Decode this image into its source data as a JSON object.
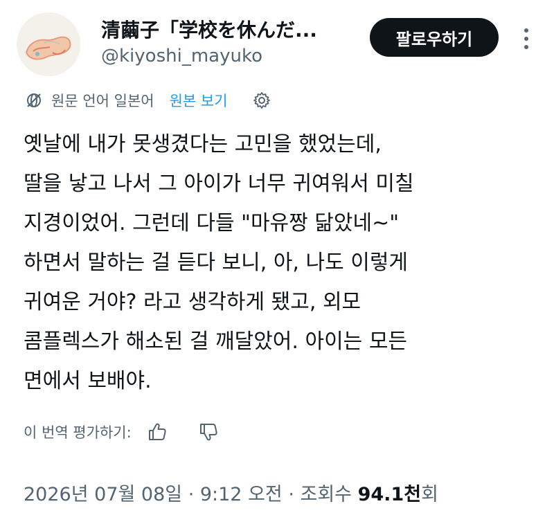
{
  "author": {
    "display_name": "清繭子「学校を休んだ...",
    "handle": "@kiyoshi_mayuko",
    "avatar_icon": "avatar-illustration"
  },
  "follow_label": "팔로우하기",
  "translation": {
    "source_language_label": "원문 언어 일본어",
    "view_original_label": "원본 보기",
    "globe_icon": "globe-slash-icon",
    "settings_icon": "gear-icon"
  },
  "tweet_lines": [
    "옛날에 내가 못생겼다는 고민을 했었는데,",
    "딸을 낳고 나서 그 아이가 너무 귀여워서 미칠",
    "지경이었어. 그런데 다들 \"마유짱 닮았네~\"",
    "하면서 말하는 걸 듣다 보니, 아, 나도 이렇게",
    "귀여운 거야? 라고 생각하게 됐고, 외모",
    "콤플렉스가 해소된 걸 깨달았어. 아이는 모든",
    "면에서 보배야."
  ],
  "rating": {
    "label": "이 번역 평가하기:",
    "thumbs_up_icon": "thumbs-up-icon",
    "thumbs_down_icon": "thumbs-down-icon"
  },
  "meta": {
    "datetime": "2026년 07월 08일 · 9:12 오전 · 조회수 ",
    "views_number": "94.1천",
    "views_suffix": "회"
  },
  "colors": {
    "primary_text": "#0f1419",
    "secondary_text": "#536471",
    "link": "#1d9bf0",
    "button_bg": "#0f1419"
  }
}
